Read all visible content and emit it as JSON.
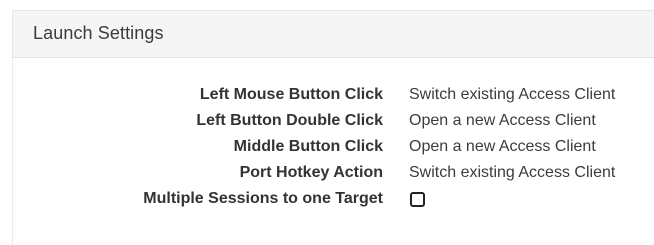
{
  "panel": {
    "title": "Launch Settings"
  },
  "settings": [
    {
      "label": "Left Mouse Button Click",
      "value": "Switch existing Access Client"
    },
    {
      "label": "Left Button Double Click",
      "value": "Open a new Access Client"
    },
    {
      "label": "Middle Button Click",
      "value": "Open a new Access Client"
    },
    {
      "label": "Port Hotkey Action",
      "value": "Switch existing Access Client"
    },
    {
      "label": "Multiple Sessions to one Target",
      "checked": false
    }
  ]
}
